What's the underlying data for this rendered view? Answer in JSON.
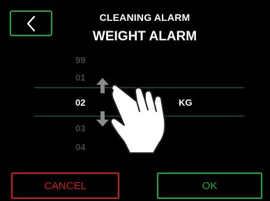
{
  "header": {
    "back_icon": "chevron-left-icon",
    "title_line1": "CLEANING ALARM",
    "title_line2": "WEIGHT ALARM"
  },
  "picker": {
    "values": [
      "99",
      "01",
      "02",
      "03",
      "04"
    ],
    "selected_value": "02",
    "unit": "KG",
    "up_icon": "arrow-up-icon",
    "down_icon": "arrow-down-icon",
    "gesture_icon": "pointing-hand-icon"
  },
  "buttons": {
    "cancel_label": "CANCEL",
    "ok_label": "OK"
  },
  "colors": {
    "background": "#000000",
    "accent_green": "#1fa93a",
    "cancel_red": "#c8201e",
    "inactive_number": "#444444",
    "selection_line": "#183b2e"
  }
}
